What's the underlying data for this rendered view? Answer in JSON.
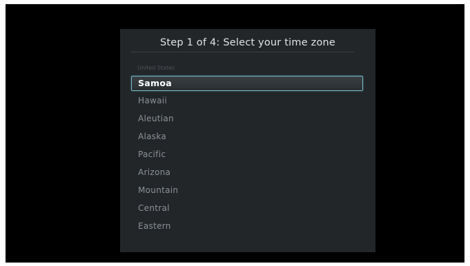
{
  "dialog": {
    "title": "Step 1 of 4: Select your time zone",
    "section_label": "United States",
    "selected_index": 0,
    "items": [
      {
        "label": "Samoa"
      },
      {
        "label": "Hawaii"
      },
      {
        "label": "Aleutian"
      },
      {
        "label": "Alaska"
      },
      {
        "label": "Pacific"
      },
      {
        "label": "Arizona"
      },
      {
        "label": "Mountain"
      },
      {
        "label": "Central"
      },
      {
        "label": "Eastern"
      }
    ]
  },
  "colors": {
    "screen_background": "#000000",
    "panel_background": "#222629",
    "selection_border": "#73bcc8",
    "title_text": "#e2e4e6",
    "item_text": "#8d9297",
    "section_text": "#4e5357"
  }
}
